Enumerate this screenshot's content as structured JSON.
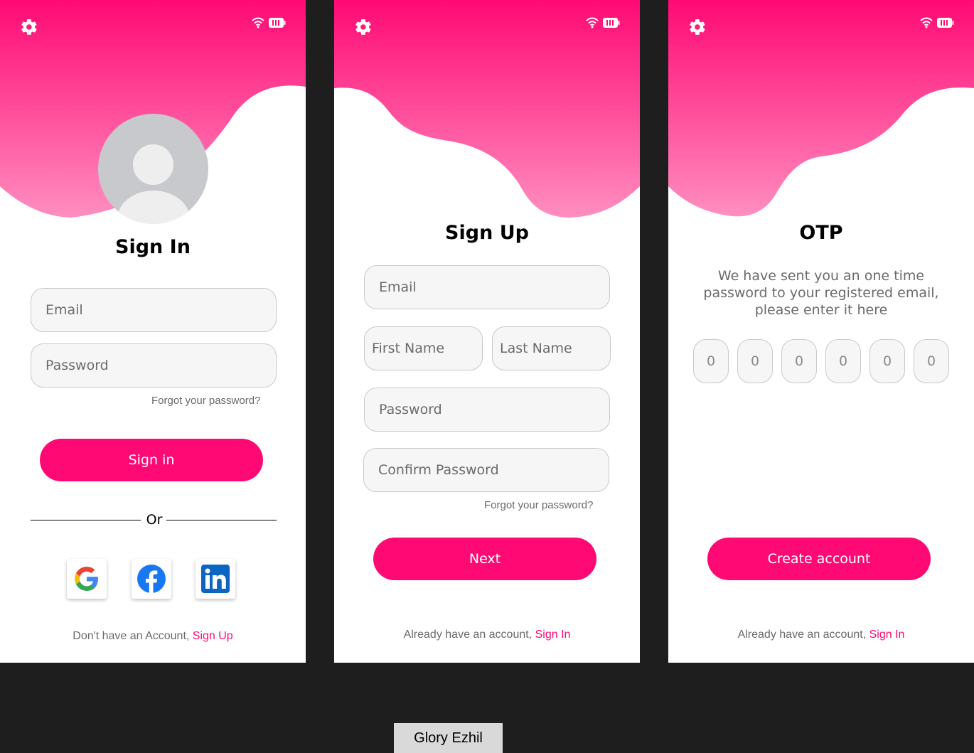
{
  "colors": {
    "accent": "#ff0a74",
    "gradient_top": "#ff0a74",
    "gradient_bottom": "#ff8ec0",
    "background": "#1e1e1e"
  },
  "icons": {
    "settings": "gear-icon",
    "wifi": "wifi-icon",
    "battery": "battery-icon"
  },
  "signin": {
    "title": "Sign In",
    "email_placeholder": "Email",
    "password_placeholder": "Password",
    "forgot": "Forgot your password?",
    "button": "Sign in",
    "or": "Or",
    "social": [
      "Google",
      "Facebook",
      "LinkedIn"
    ],
    "footer_text": "Don't have an Account, ",
    "footer_link": "Sign Up"
  },
  "signup": {
    "title": "Sign Up",
    "email_placeholder": "Email",
    "first_name_placeholder": "First Name",
    "last_name_placeholder": "Last Name",
    "password_placeholder": "Password",
    "confirm_placeholder": "Confirm Password",
    "forgot": "Forgot your password?",
    "button": "Next",
    "footer_text": "Already have an account, ",
    "footer_link": "Sign In"
  },
  "otp": {
    "title": "OTP",
    "message": "We have sent you an one time password to your registered email, please enter it here",
    "digits": [
      "0",
      "0",
      "0",
      "0",
      "0",
      "0"
    ],
    "button": "Create account",
    "footer_text": "Already have an account, ",
    "footer_link": "Sign In"
  },
  "credit": "Glory Ezhil"
}
